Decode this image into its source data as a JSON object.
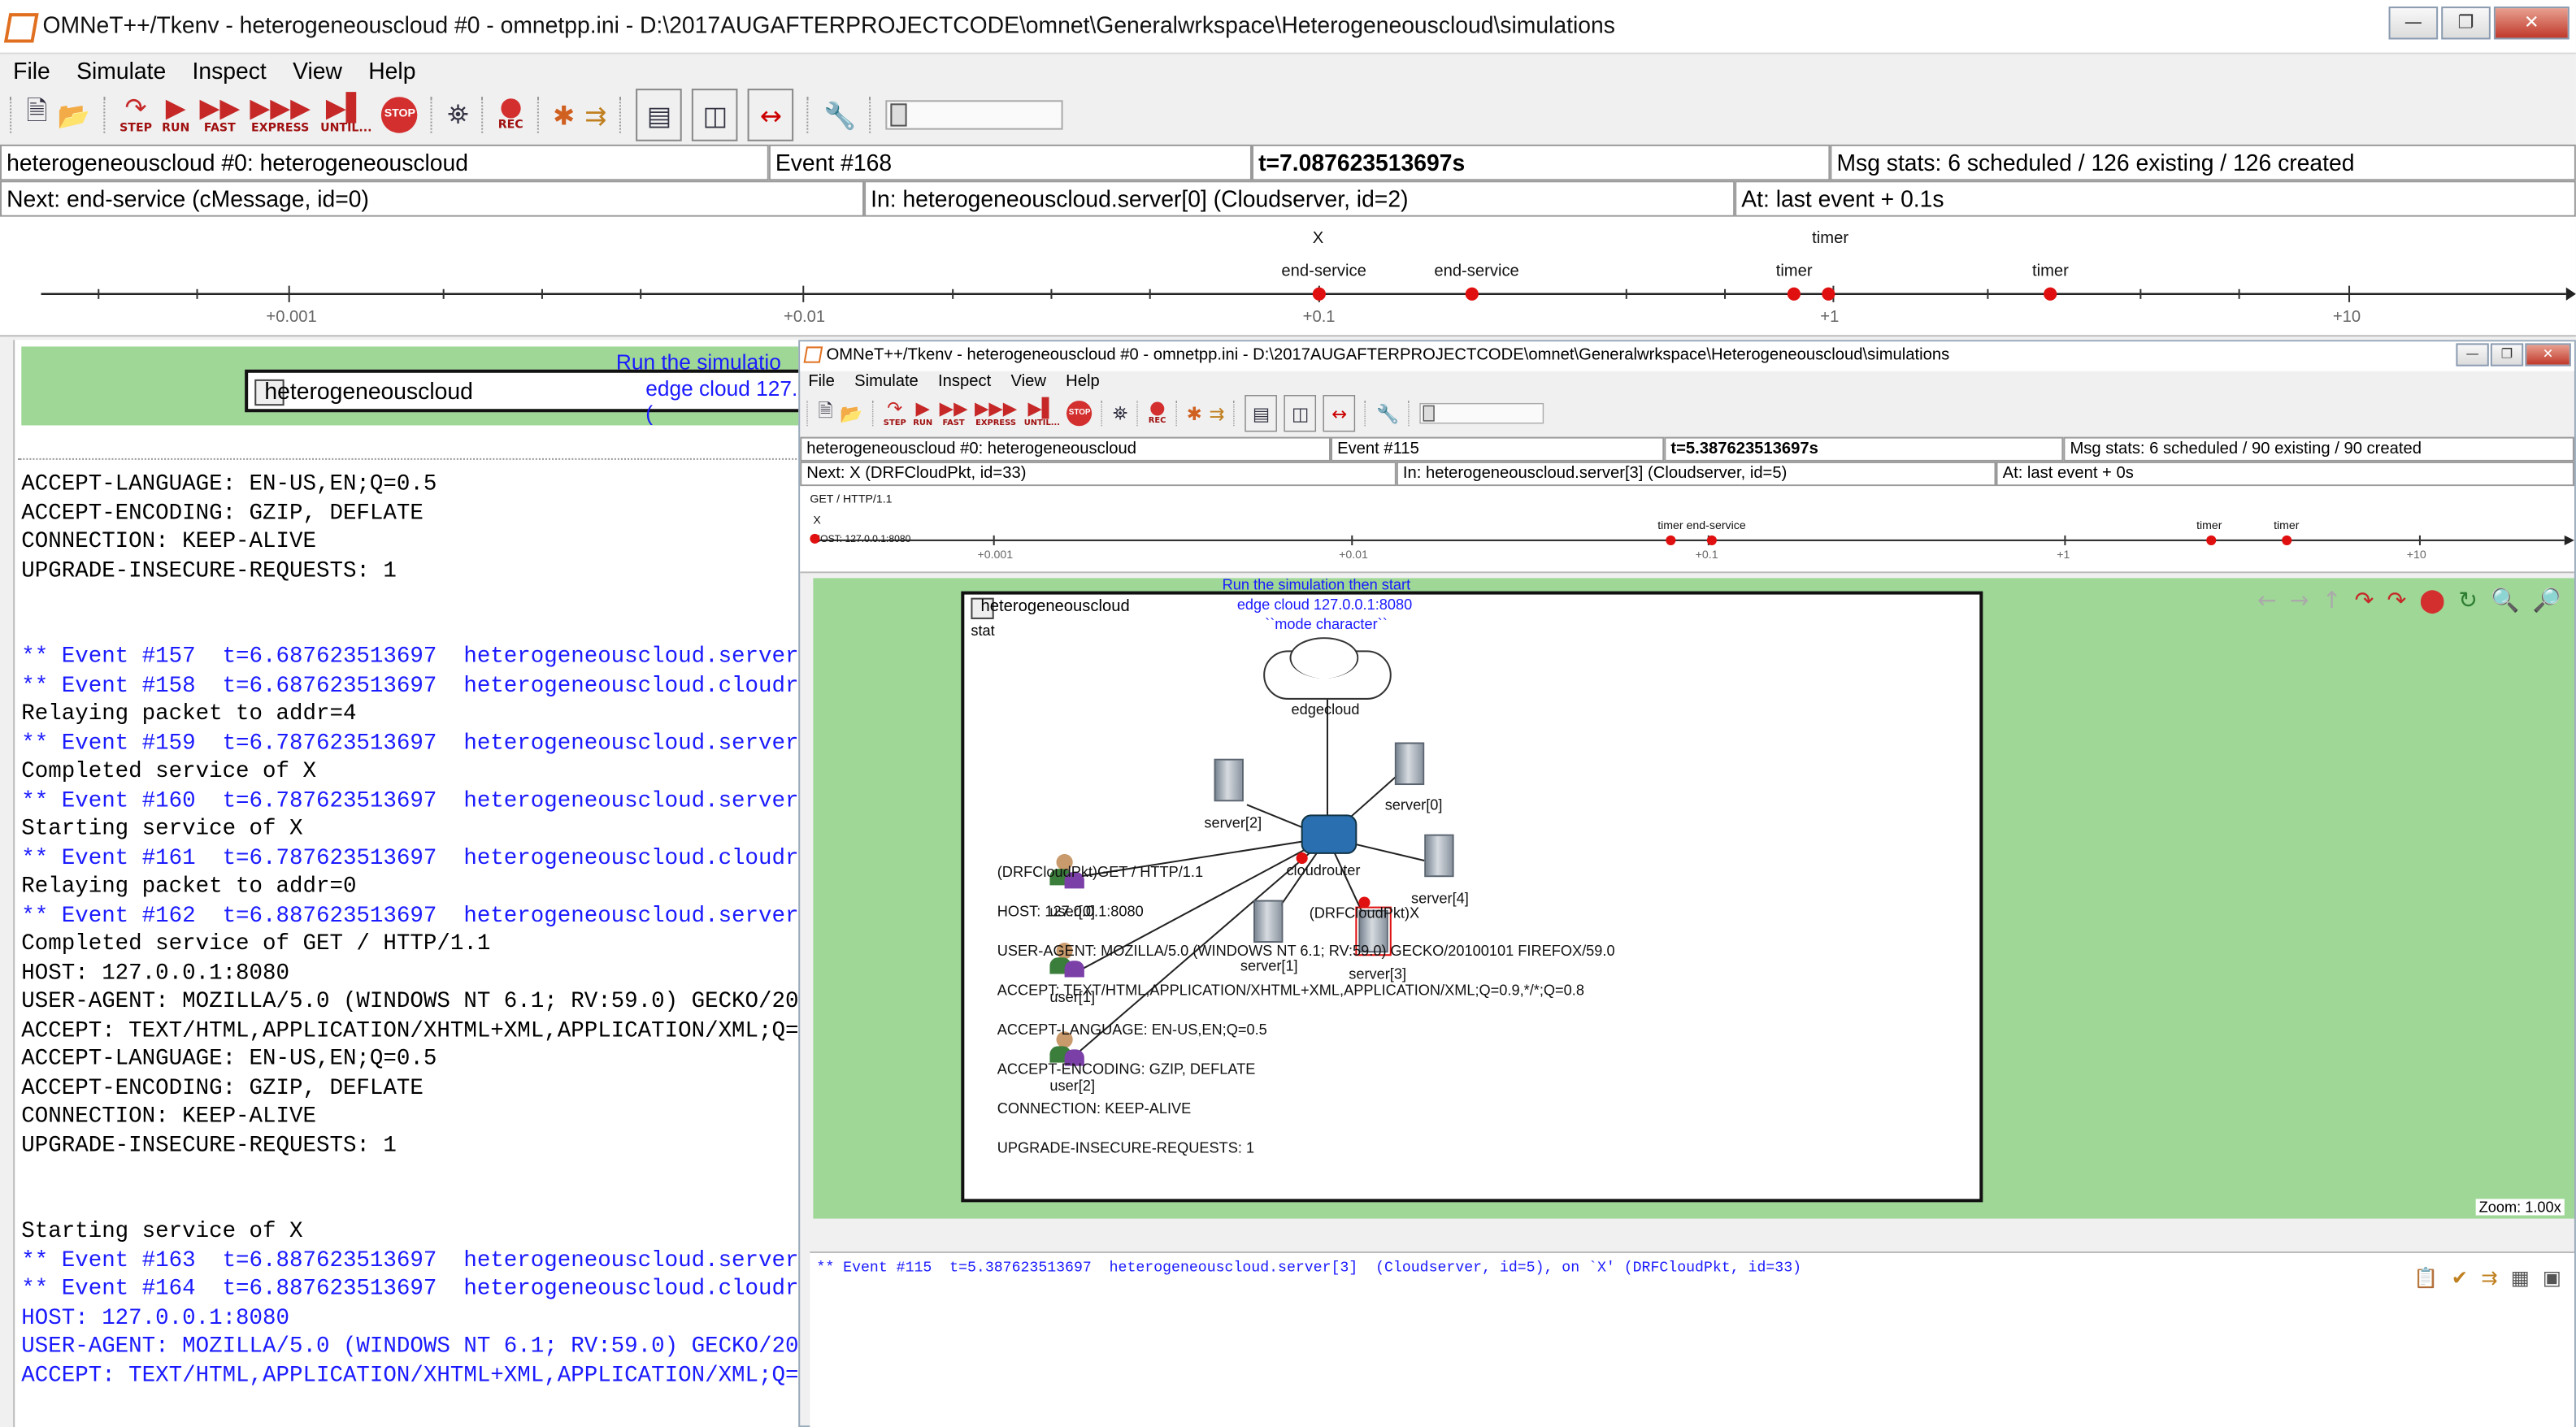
{
  "main": {
    "title": "OMNeT++/Tkenv - heterogeneouscloud #0 - omnetpp.ini - D:\\2017AUGAFTERPROJECTCODE\\omnet\\Generalwrkspace\\Heterogeneouscloud\\simulations",
    "menu": [
      "File",
      "Simulate",
      "Inspect",
      "View",
      "Help"
    ],
    "toolbar": {
      "step": "STEP",
      "run": "RUN",
      "fast": "FAST",
      "express": "EXPRESS",
      "until": "UNTIL...",
      "stop": "STOP",
      "rec": "REC"
    },
    "status": {
      "network": "heterogeneouscloud #0: heterogeneouscloud",
      "event": "Event #168",
      "time": "t=7.087623513697s",
      "msgstats": "Msg stats: 6 scheduled / 126 existing / 126 created"
    },
    "next": {
      "next": "Next: end-service (cMessage, id=0)",
      "in": "In: heterogeneouscloud.server[0] (Cloudserver, id=2)",
      "at": "At: last event + 0.1s"
    },
    "timeline": {
      "ticks": [
        "+0.001",
        "+0.01",
        "+0.1",
        "+1",
        "+10"
      ],
      "events": [
        "X",
        "end-service",
        "end-service",
        "timer",
        "timer",
        "timer"
      ]
    },
    "left_panel": {
      "hint": "Run the simulatio",
      "hint2": "edge cloud 127.(",
      "module": "heterogeneouscloud",
      "log": [
        {
          "t": "ACCEPT-LANGUAGE: EN-US,EN;Q=0.5",
          "c": "k"
        },
        {
          "t": "ACCEPT-ENCODING: GZIP, DEFLATE",
          "c": "k"
        },
        {
          "t": "CONNECTION: KEEP-ALIVE",
          "c": "k"
        },
        {
          "t": "UPGRADE-INSECURE-REQUESTS: 1",
          "c": "k"
        },
        {
          "t": "",
          "c": "k"
        },
        {
          "t": "",
          "c": "k"
        },
        {
          "t": "** Event #157  t=6.687623513697  heterogeneouscloud.server",
          "c": "b"
        },
        {
          "t": "** Event #158  t=6.687623513697  heterogeneouscloud.cloudr",
          "c": "b"
        },
        {
          "t": "Relaying packet to addr=4",
          "c": "k"
        },
        {
          "t": "** Event #159  t=6.787623513697  heterogeneouscloud.server",
          "c": "b"
        },
        {
          "t": "Completed service of X",
          "c": "k"
        },
        {
          "t": "** Event #160  t=6.787623513697  heterogeneouscloud.server",
          "c": "b"
        },
        {
          "t": "Starting service of X",
          "c": "k"
        },
        {
          "t": "** Event #161  t=6.787623513697  heterogeneouscloud.cloudr",
          "c": "b"
        },
        {
          "t": "Relaying packet to addr=0",
          "c": "k"
        },
        {
          "t": "** Event #162  t=6.887623513697  heterogeneouscloud.server",
          "c": "b"
        },
        {
          "t": "Completed service of GET / HTTP/1.1",
          "c": "k"
        },
        {
          "t": "HOST: 127.0.0.1:8080",
          "c": "k"
        },
        {
          "t": "USER-AGENT: MOZILLA/5.0 (WINDOWS NT 6.1; RV:59.0) GECKO/20",
          "c": "k"
        },
        {
          "t": "ACCEPT: TEXT/HTML,APPLICATION/XHTML+XML,APPLICATION/XML;Q=",
          "c": "k"
        },
        {
          "t": "ACCEPT-LANGUAGE: EN-US,EN;Q=0.5",
          "c": "k"
        },
        {
          "t": "ACCEPT-ENCODING: GZIP, DEFLATE",
          "c": "k"
        },
        {
          "t": "CONNECTION: KEEP-ALIVE",
          "c": "k"
        },
        {
          "t": "UPGRADE-INSECURE-REQUESTS: 1",
          "c": "k"
        },
        {
          "t": "",
          "c": "k"
        },
        {
          "t": "",
          "c": "k"
        },
        {
          "t": "Starting service of X",
          "c": "k"
        },
        {
          "t": "** Event #163  t=6.887623513697  heterogeneouscloud.server",
          "c": "b"
        },
        {
          "t": "** Event #164  t=6.887623513697  heterogeneouscloud.cloudr",
          "c": "b"
        },
        {
          "t": "HOST: 127.0.0.1:8080",
          "c": "b"
        },
        {
          "t": "USER-AGENT: MOZILLA/5.0 (WINDOWS NT 6.1; RV:59.0) GECKO/20100101 FIREFOX/59.0",
          "c": "b"
        },
        {
          "t": "ACCEPT: TEXT/HTML,APPLICATION/XHTML+XML,APPLICATION/XML;Q=0.9,*/*;Q=0.8",
          "c": "b"
        }
      ]
    }
  },
  "inner": {
    "title": "OMNeT++/Tkenv - heterogeneouscloud #0 - omnetpp.ini - D:\\2017AUGAFTERPROJECTCODE\\omnet\\Generalwrkspace\\Heterogeneouscloud\\simulations",
    "menu": [
      "File",
      "Simulate",
      "Inspect",
      "View",
      "Help"
    ],
    "status": {
      "network": "heterogeneouscloud #0: heterogeneouscloud",
      "event": "Event #115",
      "time": "t=5.387623513697s",
      "msgstats": "Msg stats: 6 scheduled / 90 existing / 90 created"
    },
    "next": {
      "next": "Next: X (DRFCloudPkt, id=33)",
      "in": "In: heterogeneouscloud.server[3] (Cloudserver, id=5)",
      "at": "At: last event + 0s"
    },
    "timeline": {
      "get": "GET / HTTP/1.1",
      "x": "X",
      "host": "HOST: 127.0.0.1:8080",
      "ticks": [
        "+0.001",
        "+0.01",
        "+0.1",
        "+1",
        "+10"
      ],
      "events": [
        "timer end-service",
        "timer",
        "timer"
      ]
    },
    "canvas": {
      "hint1": "Run the simulation then start",
      "hint2": "edge cloud 127.0.0.1:8080",
      "hint3": "``mode character``",
      "module": "heterogeneouscloud",
      "stat": "stat",
      "edgecloud": "edgecloud",
      "cloudrouter": "cloudrouter",
      "servers": [
        "server[0]",
        "server[1]",
        "server[2]",
        "server[3]",
        "server[4]"
      ],
      "users": [
        "user[0]",
        "user[1]",
        "user[2]"
      ],
      "pkt1": "(DRFCloudPkt)GET / HTTP/1.1",
      "pkt2": "(DRFCloudPkt)X",
      "lines": [
        "HOST: 127.0.0.1:8080",
        "USER-AGENT: MOZILLA/5.0 (WINDOWS NT 6.1; RV:59.0) GECKO/20100101 FIREFOX/59.0",
        "ACCEPT: TEXT/HTML,APPLICATION/XHTML+XML,APPLICATION/XML;Q=0.9,*/*;Q=0.8",
        "ACCEPT-LANGUAGE: EN-US,EN;Q=0.5",
        "ACCEPT-ENCODING: GZIP, DEFLATE",
        "CONNECTION: KEEP-ALIVE",
        "UPGRADE-INSECURE-REQUESTS: 1"
      ],
      "zoom": "Zoom: 1.00x"
    },
    "log": "** Event #115  t=5.387623513697  heterogeneouscloud.server[3]  (Cloudserver, id=5), on `X' (DRFCloudPkt, id=33)"
  }
}
